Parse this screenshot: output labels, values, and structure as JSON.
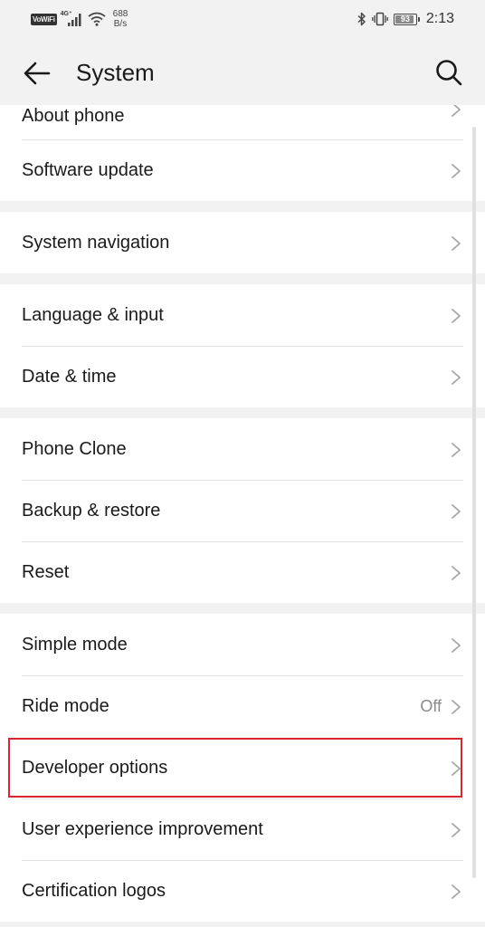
{
  "status_bar": {
    "volte": "VoWiFi",
    "network": "4G⁺",
    "speed_value": "688",
    "speed_unit": "B/s",
    "battery": "93",
    "time": "2:13"
  },
  "header": {
    "title": "System",
    "back_icon": "arrow-left-icon",
    "search_icon": "search-icon"
  },
  "groups": [
    {
      "items": [
        {
          "label": "About phone"
        },
        {
          "label": "Software update"
        }
      ]
    },
    {
      "items": [
        {
          "label": "System navigation"
        }
      ]
    },
    {
      "items": [
        {
          "label": "Language & input"
        },
        {
          "label": "Date & time"
        }
      ]
    },
    {
      "items": [
        {
          "label": "Phone Clone"
        },
        {
          "label": "Backup & restore"
        },
        {
          "label": "Reset"
        }
      ]
    },
    {
      "items": [
        {
          "label": "Simple mode"
        },
        {
          "label": "Ride mode",
          "value": "Off"
        },
        {
          "label": "Developer options",
          "highlighted": true
        },
        {
          "label": "User experience improvement"
        },
        {
          "label": "Certification logos"
        }
      ]
    }
  ],
  "colors": {
    "highlight_border": "#d9262e",
    "background": "#f2f2f2",
    "card": "#ffffff"
  }
}
